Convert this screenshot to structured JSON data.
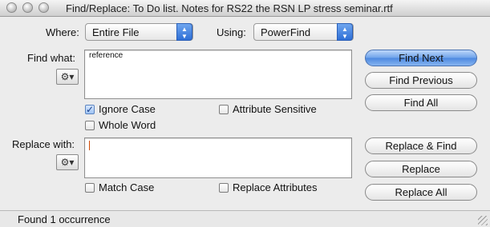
{
  "window": {
    "title": "Find/Replace:  To Do list. Notes for RS22 the RSN LP stress seminar.rtf"
  },
  "where": {
    "label": "Where:",
    "value": "Entire File"
  },
  "using": {
    "label": "Using:",
    "value": "PowerFind"
  },
  "find": {
    "label": "Find what:",
    "value": "reference",
    "options": {
      "ignore_case": {
        "label": "Ignore Case",
        "checked": true
      },
      "attribute_sensitive": {
        "label": "Attribute Sensitive",
        "checked": false
      },
      "whole_word": {
        "label": "Whole Word",
        "checked": false
      }
    }
  },
  "replace": {
    "label": "Replace with:",
    "value": "",
    "options": {
      "match_case": {
        "label": "Match Case",
        "checked": false
      },
      "replace_attributes": {
        "label": "Replace Attributes",
        "checked": false
      }
    }
  },
  "buttons": {
    "find_next": "Find Next",
    "find_previous": "Find Previous",
    "find_all": "Find All",
    "replace_and_find": "Replace & Find",
    "replace": "Replace",
    "replace_all": "Replace All"
  },
  "icons": {
    "gear": "gear-icon",
    "popup_arrows": "up-down-arrows-icon"
  },
  "status": {
    "text": "Found 1 occurrence"
  },
  "colors": {
    "default_button": "#6ea2ea",
    "popup_accent": "#2e6fd6"
  }
}
